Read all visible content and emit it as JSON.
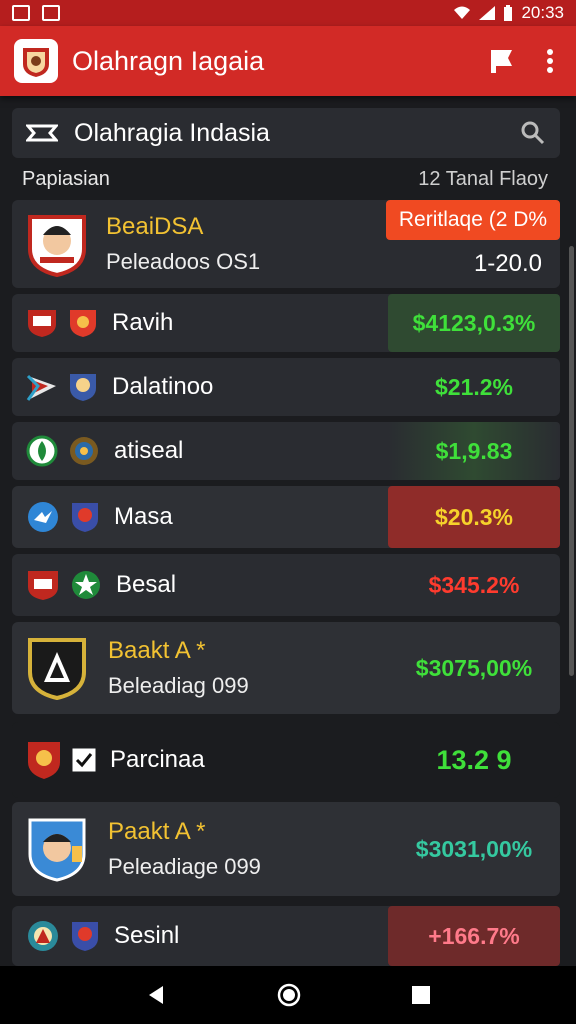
{
  "status": {
    "time": "20:33"
  },
  "app": {
    "title": "Olahragn Iagaia"
  },
  "search": {
    "label": "Olahragia Indasia"
  },
  "header": {
    "left": "Papiasian",
    "right": "12 Tanal Flaoy"
  },
  "rows": [
    {
      "name": "BeaiDSA",
      "sub": "Peleadoos OS1",
      "badge": "Reritlaqe (2 D%",
      "value": "1-20.0"
    },
    {
      "name": "Ravih",
      "value": "$4123,0.3%"
    },
    {
      "name": "Dalatinoo",
      "value": "$21.2%"
    },
    {
      "name": "atiseal",
      "value": "$1,9.83"
    },
    {
      "name": "Masa",
      "value": "$20.3%"
    },
    {
      "name": "Besal",
      "value": "$345.2%"
    },
    {
      "name": "Baakt A *",
      "sub": "Beleadiag 099",
      "value": "$3075,00%"
    },
    {
      "name": "Parcinaa",
      "value": "13.2 9"
    },
    {
      "name": "Paakt A *",
      "sub": "Peleadiage 099",
      "value": "$3031,00%"
    },
    {
      "name": "Sesinl",
      "value": "+166.7%"
    }
  ],
  "colors": {
    "accent": "#d22a26",
    "statusbar": "#b51e1e",
    "positive": "#3fe03a",
    "negative": "#ff3b2e"
  }
}
